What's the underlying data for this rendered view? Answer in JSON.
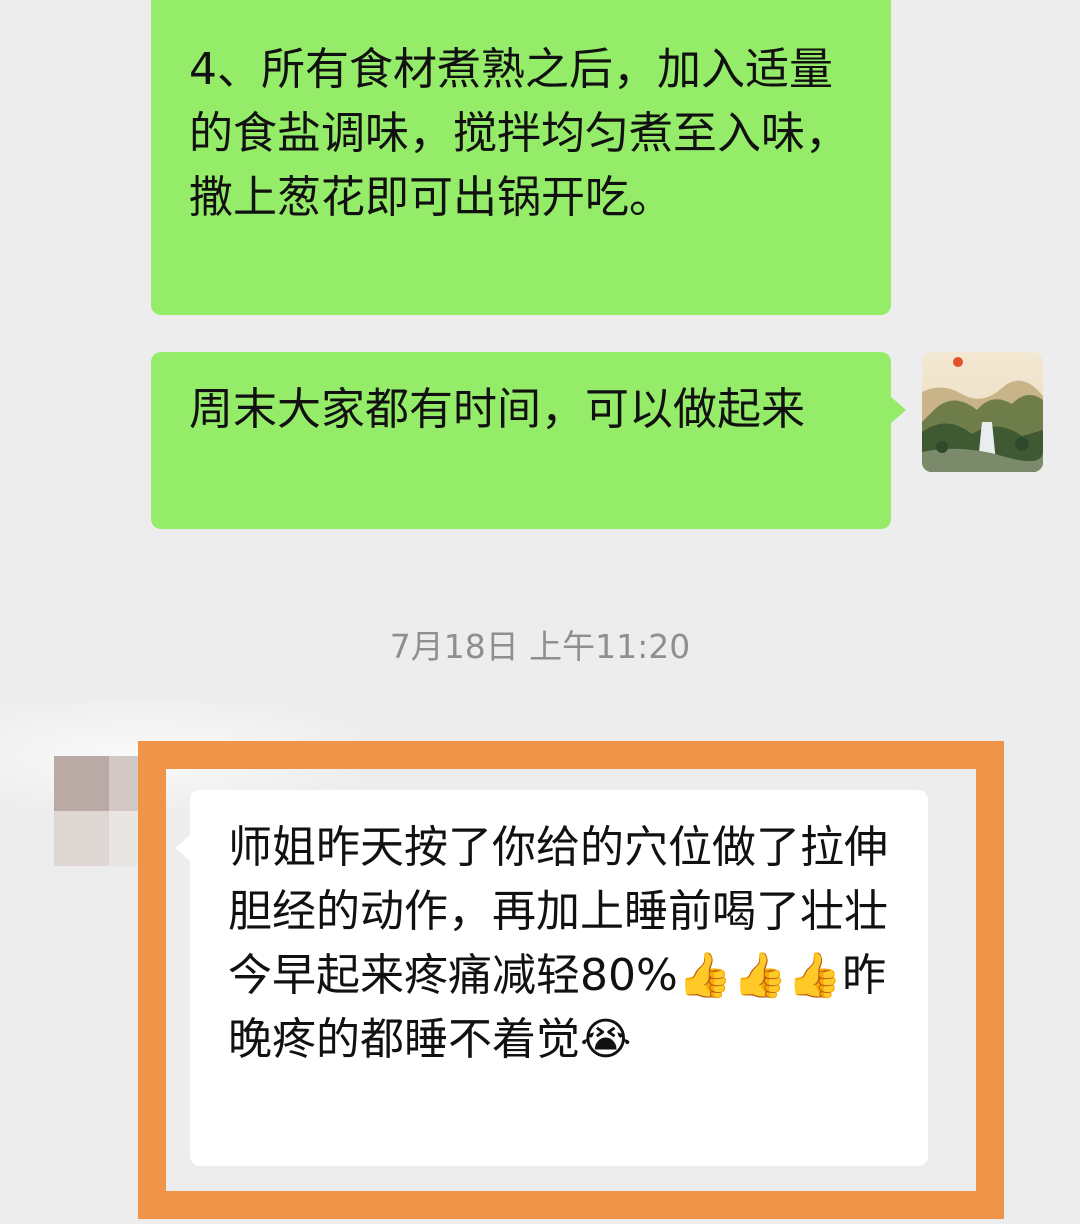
{
  "messages": [
    {
      "sender": "self",
      "text": "4、所有食材煮熟之后，加入适量的食盐调味，搅拌均匀煮至入味，撒上葱花即可出锅开吃。"
    },
    {
      "sender": "self",
      "text": "周末大家都有时间，可以做起来"
    }
  ],
  "timestamp": "7月18日 上午11:20",
  "incoming": {
    "sender": "other",
    "text": "师姐昨天按了你给的穴位做了拉伸胆经的动作，再加上睡前喝了壮壮今早起来疼痛减轻80%👍👍👍昨晚疼的都睡不着觉😭"
  },
  "colors": {
    "self_bubble": "#95ec69",
    "other_bubble": "#ffffff",
    "background": "#ededed",
    "highlight": "#ee9549",
    "timestamp_text": "#8f8f8f"
  },
  "icons": {
    "self_avatar": "landscape-painting-avatar",
    "other_avatar": "blurred-avatar"
  }
}
